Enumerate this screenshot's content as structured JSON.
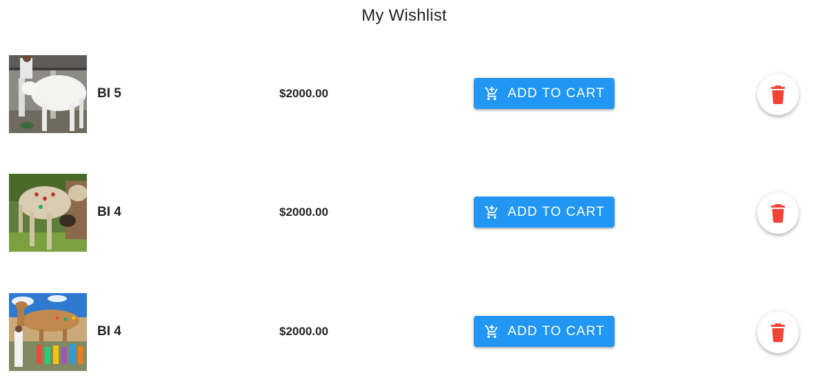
{
  "page": {
    "title": "My Wishlist"
  },
  "colors": {
    "primary": "#2196f3",
    "delete": "#f44336"
  },
  "wishlist": {
    "items": [
      {
        "name": "BI 5",
        "price": "$2000.00",
        "image_icon": "white-goat-photo",
        "cart_label": "ADD TO CART",
        "cart_icon": "add-shopping-cart-icon",
        "delete_icon": "trash-icon"
      },
      {
        "name": "BI 4",
        "price": "$2000.00",
        "image_icon": "decorated-camel-photo",
        "cart_label": "ADD TO CART",
        "cart_icon": "add-shopping-cart-icon",
        "delete_icon": "trash-icon"
      },
      {
        "name": "BI 4",
        "price": "$2000.00",
        "image_icon": "camel-festival-photo",
        "cart_label": "ADD TO CART",
        "cart_icon": "add-shopping-cart-icon",
        "delete_icon": "trash-icon"
      }
    ]
  }
}
